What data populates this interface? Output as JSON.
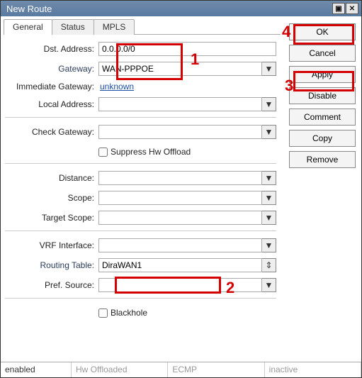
{
  "window": {
    "title": "New Route"
  },
  "titlebar": {
    "dock_icon": "▣",
    "close_icon": "✕"
  },
  "tabs": [
    {
      "label": "General",
      "active": true
    },
    {
      "label": "Status",
      "active": false
    },
    {
      "label": "MPLS",
      "active": false
    }
  ],
  "form": {
    "dst_address_label": "Dst. Address:",
    "dst_address_value": "0.0.0.0/0",
    "gateway_label": "Gateway:",
    "gateway_value": "WAN-PPPOE",
    "immediate_gateway_label": "Immediate Gateway:",
    "immediate_gateway_value": "unknown",
    "local_address_label": "Local Address:",
    "local_address_value": "",
    "check_gateway_label": "Check Gateway:",
    "check_gateway_value": "",
    "suppress_hw_label": "Suppress Hw Offload",
    "distance_label": "Distance:",
    "distance_value": "",
    "scope_label": "Scope:",
    "scope_value": "",
    "target_scope_label": "Target Scope:",
    "target_scope_value": "",
    "vrf_interface_label": "VRF Interface:",
    "vrf_interface_value": "",
    "routing_table_label": "Routing Table:",
    "routing_table_value": "DiraWAN1",
    "pref_source_label": "Pref. Source:",
    "pref_source_value": "",
    "blackhole_label": "Blackhole"
  },
  "buttons": {
    "ok": "OK",
    "cancel": "Cancel",
    "apply": "Apply",
    "disable": "Disable",
    "comment": "Comment",
    "copy": "Copy",
    "remove": "Remove"
  },
  "status": {
    "enabled": "enabled",
    "hw": "Hw Offloaded",
    "ecmp": "ECMP",
    "inactive": "inactive"
  },
  "icons": {
    "dropdown": "▼",
    "updown": "⇕"
  },
  "callouts": {
    "c1": "1",
    "c2": "2",
    "c3": "3",
    "c4": "4"
  }
}
